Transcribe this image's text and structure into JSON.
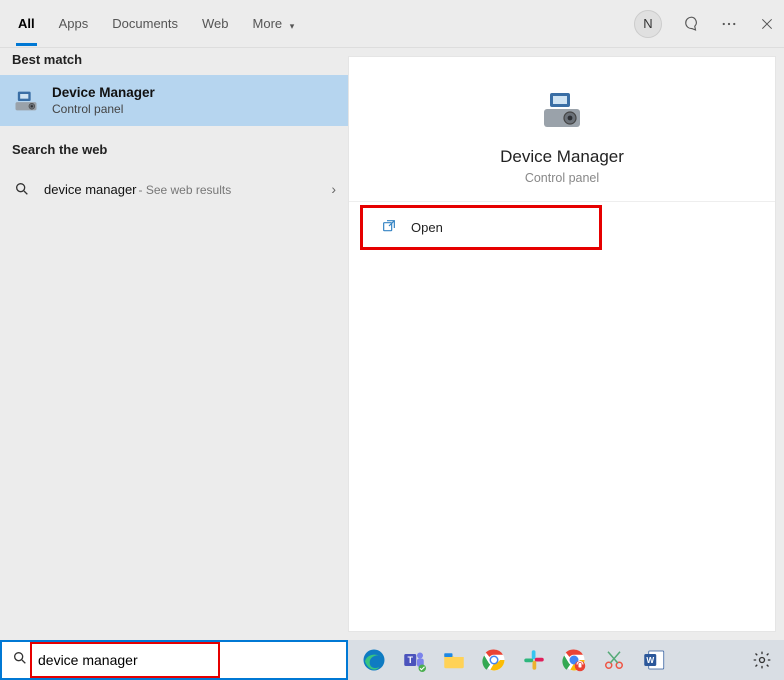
{
  "header": {
    "tabs": [
      "All",
      "Apps",
      "Documents",
      "Web",
      "More"
    ],
    "moreChevron": "▾",
    "avatarInitial": "N"
  },
  "left": {
    "bestMatchLabel": "Best match",
    "bestMatch": {
      "title": "Device Manager",
      "subtitle": "Control panel"
    },
    "webLabel": "Search the web",
    "webResult": {
      "query": "device manager",
      "hint": " - See web results"
    }
  },
  "preview": {
    "title": "Device Manager",
    "subtitle": "Control panel",
    "openLabel": "Open"
  },
  "search": {
    "value": "device manager"
  }
}
